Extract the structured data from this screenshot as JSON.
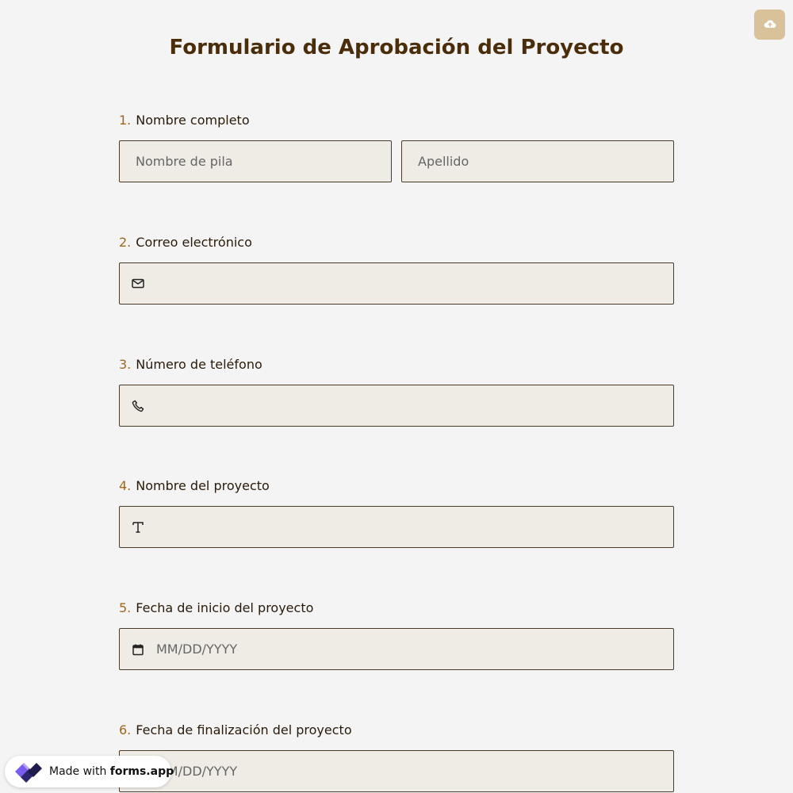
{
  "form": {
    "title": "Formulario de Aprobación del Proyecto"
  },
  "questions": [
    {
      "number": "1.",
      "label": "Nombre completo",
      "fields": [
        {
          "placeholder": "Nombre de pila",
          "value": ""
        },
        {
          "placeholder": "Apellido",
          "value": ""
        }
      ]
    },
    {
      "number": "2.",
      "label": "Correo electrónico",
      "icon": "envelope-icon",
      "placeholder": "",
      "value": ""
    },
    {
      "number": "3.",
      "label": "Número de teléfono",
      "icon": "phone-icon",
      "placeholder": "",
      "value": ""
    },
    {
      "number": "4.",
      "label": "Nombre del proyecto",
      "icon": "text-icon",
      "placeholder": "",
      "value": ""
    },
    {
      "number": "5.",
      "label": "Fecha de inicio del proyecto",
      "icon": "calendar-icon",
      "placeholder": "MM/DD/YYYY",
      "value": ""
    },
    {
      "number": "6.",
      "label": "Fecha de finalización del proyecto",
      "icon": "calendar-icon",
      "placeholder": "MM/DD/YYYY",
      "value": ""
    }
  ],
  "upload": {
    "icon": "cloud-upload-icon"
  },
  "badge": {
    "prefix": "Made with",
    "brand": "forms.app",
    "icon": "forms-app-logo-icon"
  },
  "colors": {
    "background": "#f4f4f4",
    "title": "#4a2e0c",
    "question_number": "#a0661b",
    "field_background": "#efebe5",
    "field_border": "#4a3a2a",
    "upload_button": "#d9c29a"
  }
}
